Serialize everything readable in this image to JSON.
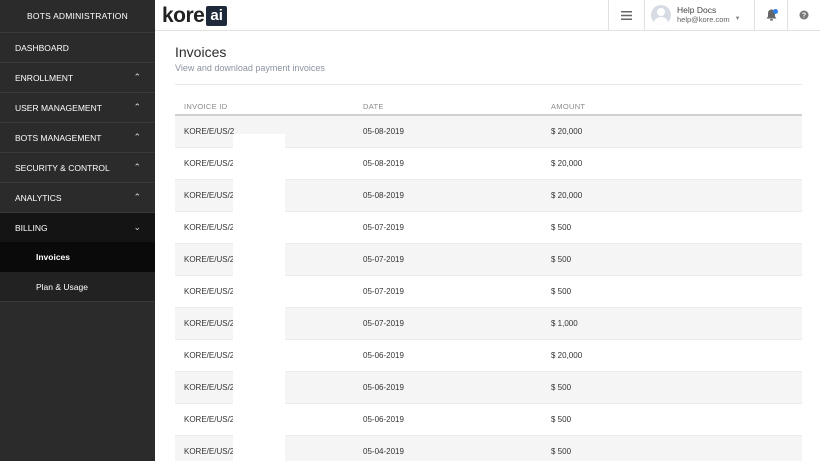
{
  "sidebar": {
    "header": "BOTS ADMINISTRATION",
    "items": [
      {
        "label": "DASHBOARD",
        "chevron": ""
      },
      {
        "label": "ENROLLMENT",
        "chevron": "⌃"
      },
      {
        "label": "USER MANAGEMENT",
        "chevron": "⌃"
      },
      {
        "label": "BOTS MANAGEMENT",
        "chevron": "⌃"
      },
      {
        "label": "SECURITY & CONTROL",
        "chevron": "⌃"
      },
      {
        "label": "ANALYTICS",
        "chevron": "⌃"
      },
      {
        "label": "BILLING",
        "chevron": "⌄"
      }
    ],
    "subitems": [
      {
        "label": "Invoices"
      },
      {
        "label": "Plan & Usage"
      }
    ]
  },
  "topbar": {
    "logo_text": "kore",
    "logo_box": "ai",
    "user_name": "Help Docs",
    "user_email": "help@kore.com"
  },
  "main": {
    "title": "Invoices",
    "subtitle": "View and download payment invoices",
    "columns": [
      "INVOICE ID",
      "DATE",
      "AMOUNT"
    ],
    "rows": [
      {
        "id": "KORE/E/US/2",
        "date": "05-08-2019",
        "amount": "$ 20,000"
      },
      {
        "id": "KORE/E/US/2",
        "date": "05-08-2019",
        "amount": "$ 20,000"
      },
      {
        "id": "KORE/E/US/2",
        "date": "05-08-2019",
        "amount": "$ 20,000"
      },
      {
        "id": "KORE/E/US/2",
        "date": "05-07-2019",
        "amount": "$ 500"
      },
      {
        "id": "KORE/E/US/2",
        "date": "05-07-2019",
        "amount": "$ 500"
      },
      {
        "id": "KORE/E/US/2",
        "date": "05-07-2019",
        "amount": "$ 500"
      },
      {
        "id": "KORE/E/US/2",
        "date": "05-07-2019",
        "amount": "$ 1,000"
      },
      {
        "id": "KORE/E/US/2",
        "date": "05-06-2019",
        "amount": "$ 20,000"
      },
      {
        "id": "KORE/E/US/2",
        "date": "05-06-2019",
        "amount": "$ 500"
      },
      {
        "id": "KORE/E/US/2",
        "date": "05-06-2019",
        "amount": "$ 500"
      },
      {
        "id": "KORE/E/US/2",
        "date": "05-04-2019",
        "amount": "$ 500"
      }
    ]
  }
}
